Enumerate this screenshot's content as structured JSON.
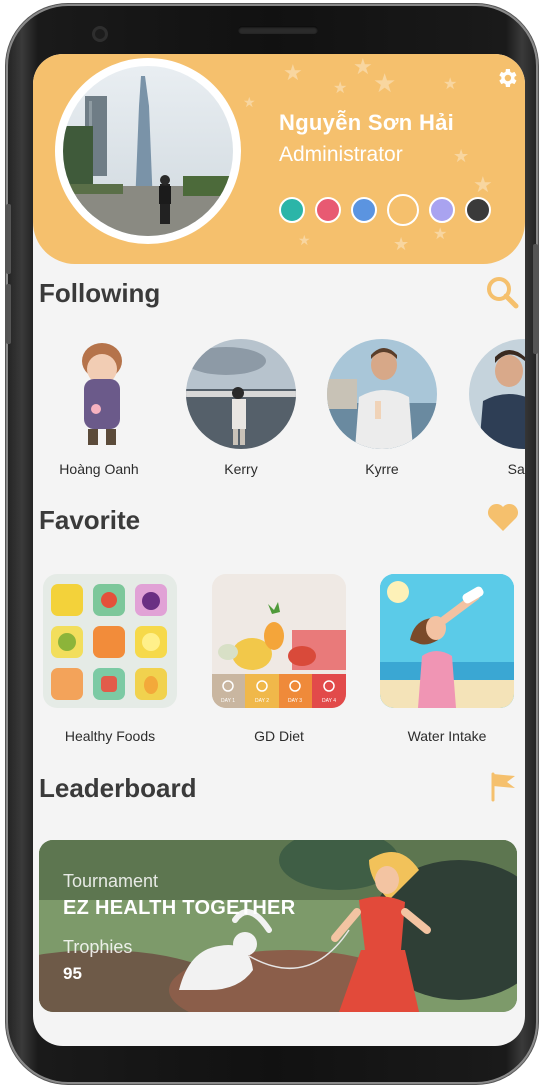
{
  "profile": {
    "name": "Nguyễn Sơn Hải",
    "role": "Administrator",
    "theme_colors": [
      "#2bb5a8",
      "#e85a72",
      "#5b94e0",
      "#f5c06d",
      "#a9a3f0",
      "#3a3a3a"
    ],
    "selected_theme": "#f5c06d"
  },
  "sections": {
    "following": "Following",
    "favorite": "Favorite",
    "leaderboard": "Leaderboard"
  },
  "following": [
    {
      "name": "Hoàng Oanh"
    },
    {
      "name": "Kerry"
    },
    {
      "name": "Kyrre"
    },
    {
      "name": "Sand"
    }
  ],
  "favorites": [
    {
      "label": "Healthy Foods"
    },
    {
      "label": "GD Diet",
      "days": [
        "DAY 1",
        "DAY 2",
        "DAY 3",
        "DAY 4"
      ]
    },
    {
      "label": "Water Intake"
    }
  ],
  "leaderboard": {
    "tournament_label": "Tournament",
    "tournament_name": "EZ HEALTH TOGETHER",
    "trophies_label": "Trophies",
    "trophies_value": "95"
  },
  "icons": {
    "settings": "gear-icon",
    "search": "search-icon",
    "favorite": "heart-icon",
    "leaderboard": "flag-icon"
  },
  "colors": {
    "accent": "#f5c06d",
    "header_bg": "#f5c06d",
    "text_dark": "#3a3a3a"
  }
}
